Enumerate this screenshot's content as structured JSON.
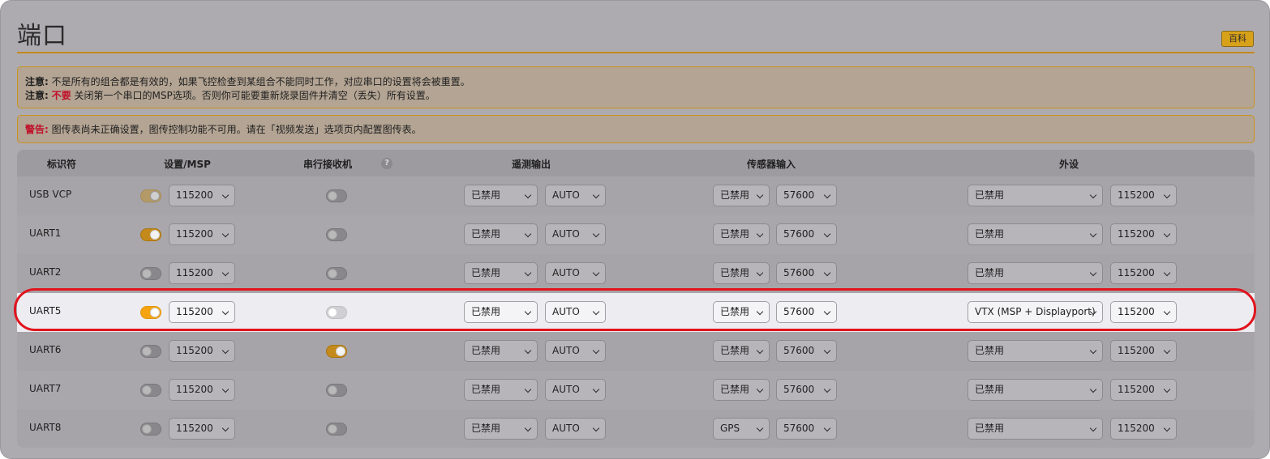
{
  "page": {
    "title": "端口",
    "wiki_label": "百科"
  },
  "notes": {
    "line1_label": "注意:",
    "line1_text": "不是所有的组合都是有效的，如果飞控检查到某组合不能同时工作，对应串口的设置将会被重置。",
    "line2_label": "注意:",
    "line2_emph": "不要",
    "line2_text": "关闭第一个串口的MSP选项。否则你可能要重新烧录固件并清空（丢失）所有设置。"
  },
  "warning": {
    "label": "警告:",
    "text": "图传表尚未正确设置，图传控制功能不可用。请在「视频发送」选项页内配置图传表。"
  },
  "columns": {
    "identifier": "标识符",
    "config_msp": "设置/MSP",
    "serial_rx": "串行接收机",
    "help_icon": "?",
    "telemetry": "遥测输出",
    "sensor": "传感器输入",
    "peripherals": "外设"
  },
  "rows": [
    {
      "id": "USB VCP",
      "msp_toggle": "dim",
      "msp_baud": "115200",
      "rx_toggle": "off",
      "tel_mode": "已禁用",
      "tel_baud": "AUTO",
      "sensor_mode": "已禁用",
      "sensor_baud": "57600",
      "peri_mode": "已禁用",
      "peri_baud": "115200"
    },
    {
      "id": "UART1",
      "msp_toggle": "on",
      "msp_baud": "115200",
      "rx_toggle": "off",
      "tel_mode": "已禁用",
      "tel_baud": "AUTO",
      "sensor_mode": "已禁用",
      "sensor_baud": "57600",
      "peri_mode": "已禁用",
      "peri_baud": "115200"
    },
    {
      "id": "UART2",
      "msp_toggle": "off",
      "msp_baud": "115200",
      "rx_toggle": "off",
      "tel_mode": "已禁用",
      "tel_baud": "AUTO",
      "sensor_mode": "已禁用",
      "sensor_baud": "57600",
      "peri_mode": "已禁用",
      "peri_baud": "115200"
    },
    {
      "id": "UART5",
      "msp_toggle": "on",
      "msp_baud": "115200",
      "rx_toggle": "off",
      "tel_mode": "已禁用",
      "tel_baud": "AUTO",
      "sensor_mode": "已禁用",
      "sensor_baud": "57600",
      "peri_mode": "VTX (MSP + Displayport)",
      "peri_baud": "115200"
    },
    {
      "id": "UART6",
      "msp_toggle": "off",
      "msp_baud": "115200",
      "rx_toggle": "on",
      "tel_mode": "已禁用",
      "tel_baud": "AUTO",
      "sensor_mode": "已禁用",
      "sensor_baud": "57600",
      "peri_mode": "已禁用",
      "peri_baud": "115200"
    },
    {
      "id": "UART7",
      "msp_toggle": "off",
      "msp_baud": "115200",
      "rx_toggle": "off",
      "tel_mode": "已禁用",
      "tel_baud": "AUTO",
      "sensor_mode": "已禁用",
      "sensor_baud": "57600",
      "peri_mode": "已禁用",
      "peri_baud": "115200"
    },
    {
      "id": "UART8",
      "msp_toggle": "off",
      "msp_baud": "115200",
      "rx_toggle": "off",
      "tel_mode": "已禁用",
      "tel_baud": "AUTO",
      "sensor_mode": "GPS",
      "sensor_baud": "57600",
      "peri_mode": "已禁用",
      "peri_baud": "115200"
    }
  ],
  "colors": {
    "accent": "#c48a1c",
    "highlight_ring": "#e0141e",
    "warning_red": "#c0102a"
  }
}
